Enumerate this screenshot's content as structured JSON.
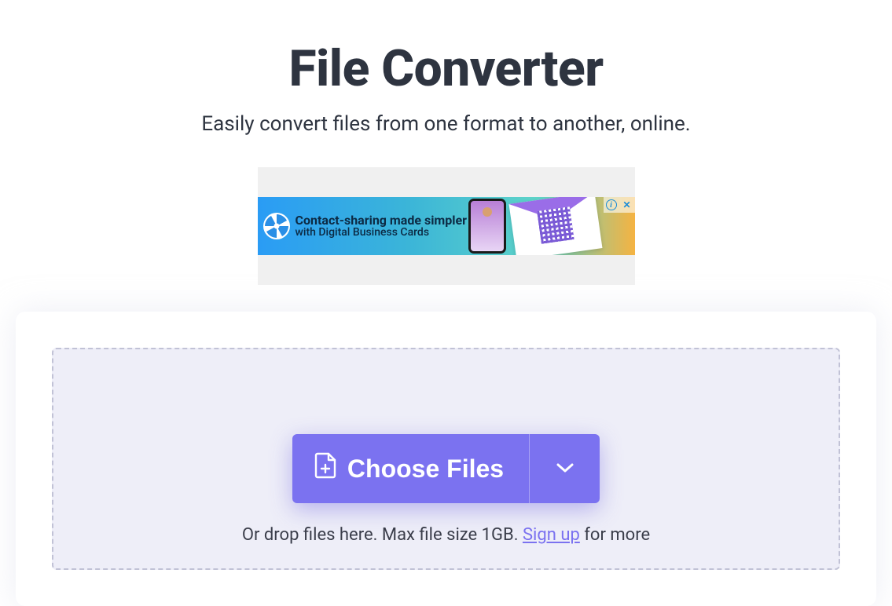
{
  "header": {
    "title": "File Converter",
    "subtitle": "Easily convert files from one format to another, online."
  },
  "ad": {
    "headline": "Contact-sharing made simpler",
    "subhead": "with Digital Business Cards",
    "info_glyph": "i",
    "close_glyph": "✕"
  },
  "dropzone": {
    "choose_label": "Choose Files",
    "hint_prefix": "Or drop files here. Max file size 1GB. ",
    "signup_label": "Sign up",
    "hint_suffix": " for more"
  },
  "colors": {
    "accent": "#7b72f0",
    "heading": "#2e3440",
    "dropzone_bg": "#eeeef8",
    "dropzone_border": "#c1c2d6"
  }
}
